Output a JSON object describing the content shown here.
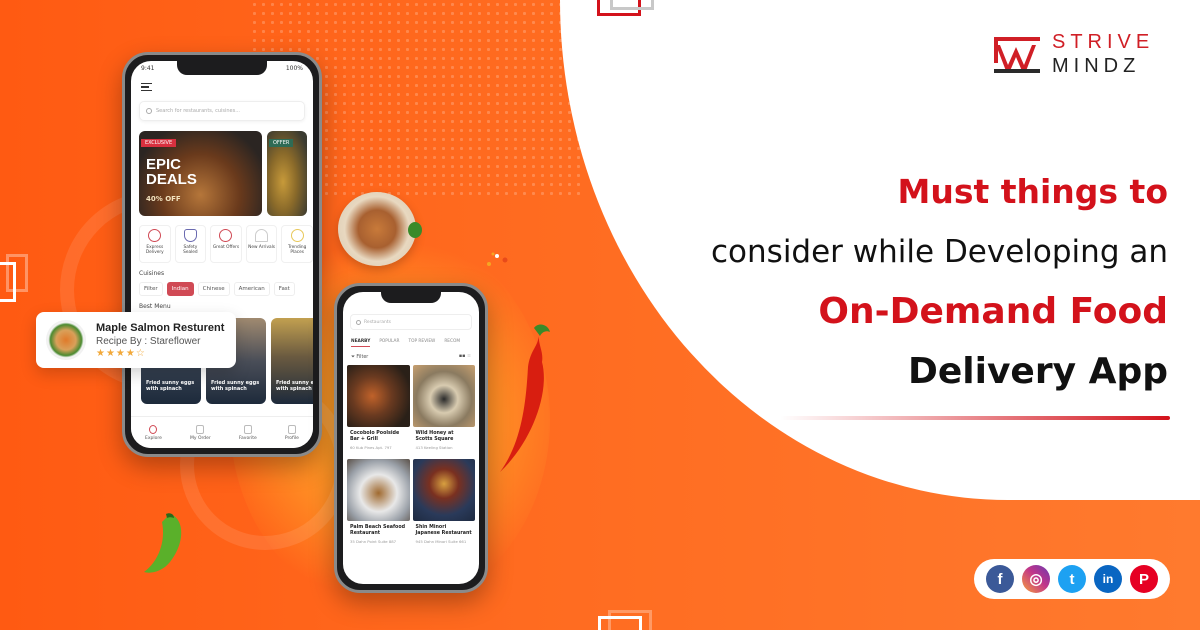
{
  "brand": {
    "name_line1": "STRIVE",
    "name_line2": "MINDZ",
    "colors": {
      "primary_red": "#d3121b",
      "orange": "#ff6a1f",
      "dark": "#111111"
    }
  },
  "headline": {
    "line1": "Must things to",
    "line2": "consider while Developing an",
    "line3": "On-Demand Food",
    "line4": "Delivery App"
  },
  "phone1": {
    "status": {
      "time": "9:41",
      "battery": "100%"
    },
    "menu_icon": "hamburger-icon",
    "search_placeholder": "Search for restaurants, cuisines...",
    "banners": [
      {
        "tag": "EXCLUSIVE",
        "title_line1": "EPIC",
        "title_line2": "DEALS",
        "subtitle": "40% OFF"
      },
      {
        "tag": "OFFER"
      }
    ],
    "categories": [
      {
        "label": "Express Delivery",
        "icon": "delivery-icon"
      },
      {
        "label": "Safety Sealed",
        "icon": "shield-check-icon"
      },
      {
        "label": "Great Offers",
        "icon": "percent-icon"
      },
      {
        "label": "New Arrivals",
        "icon": "cloche-icon"
      },
      {
        "label": "Trending Places",
        "icon": "heart-icon"
      }
    ],
    "cuisines_label": "Cuisines",
    "cuisine_chips": [
      "Filter",
      "Indian",
      "Chinese",
      "American",
      "Fast"
    ],
    "active_cuisine": "Indian",
    "best_menu_label": "Best Menu",
    "menu_cards": [
      {
        "title": "Fried sunny eggs with spinach"
      },
      {
        "title": "Fried sunny eggs with spinach"
      },
      {
        "title": "Fried sunny eggs with spinach"
      }
    ],
    "tabbar": [
      "Explore",
      "My Order",
      "Favorite",
      "Profile"
    ],
    "active_tab": "Explore"
  },
  "float_card": {
    "title": "Maple Salmon Resturent",
    "subtitle": "Recipe By : Stareflower",
    "rating": 4,
    "rating_max": 5,
    "stars_text": "★★★★☆"
  },
  "phone2": {
    "search_placeholder": "Restaurants",
    "tabs": [
      "NEARBY",
      "POPULAR",
      "TOP REVIEW",
      "RECOM"
    ],
    "active_tab": "NEARBY",
    "filter_label": "Filter",
    "restaurants": [
      {
        "name": "Cocobolo Poolside Bar + Grill",
        "address": "60 Kub Pines Apt. 797"
      },
      {
        "name": "Wild Honey at Scotts Square",
        "address": "413 Keeling Station"
      },
      {
        "name": "Palm Beach Seafood Restaurant",
        "address": "35 Dahn Point Suite 887"
      },
      {
        "name": "Shin Minori Japanese Restaurant",
        "address": "945 Dahn Minori Suite 661"
      }
    ]
  },
  "socials": [
    {
      "name": "Facebook",
      "glyph": "f",
      "color": "#3b5998"
    },
    {
      "name": "Instagram",
      "glyph": "◎",
      "color": "#c1358a"
    },
    {
      "name": "Twitter",
      "glyph": "t",
      "color": "#1da1f2"
    },
    {
      "name": "LinkedIn",
      "glyph": "in",
      "color": "#0a66c2"
    },
    {
      "name": "Pinterest",
      "glyph": "P",
      "color": "#e60023"
    }
  ]
}
